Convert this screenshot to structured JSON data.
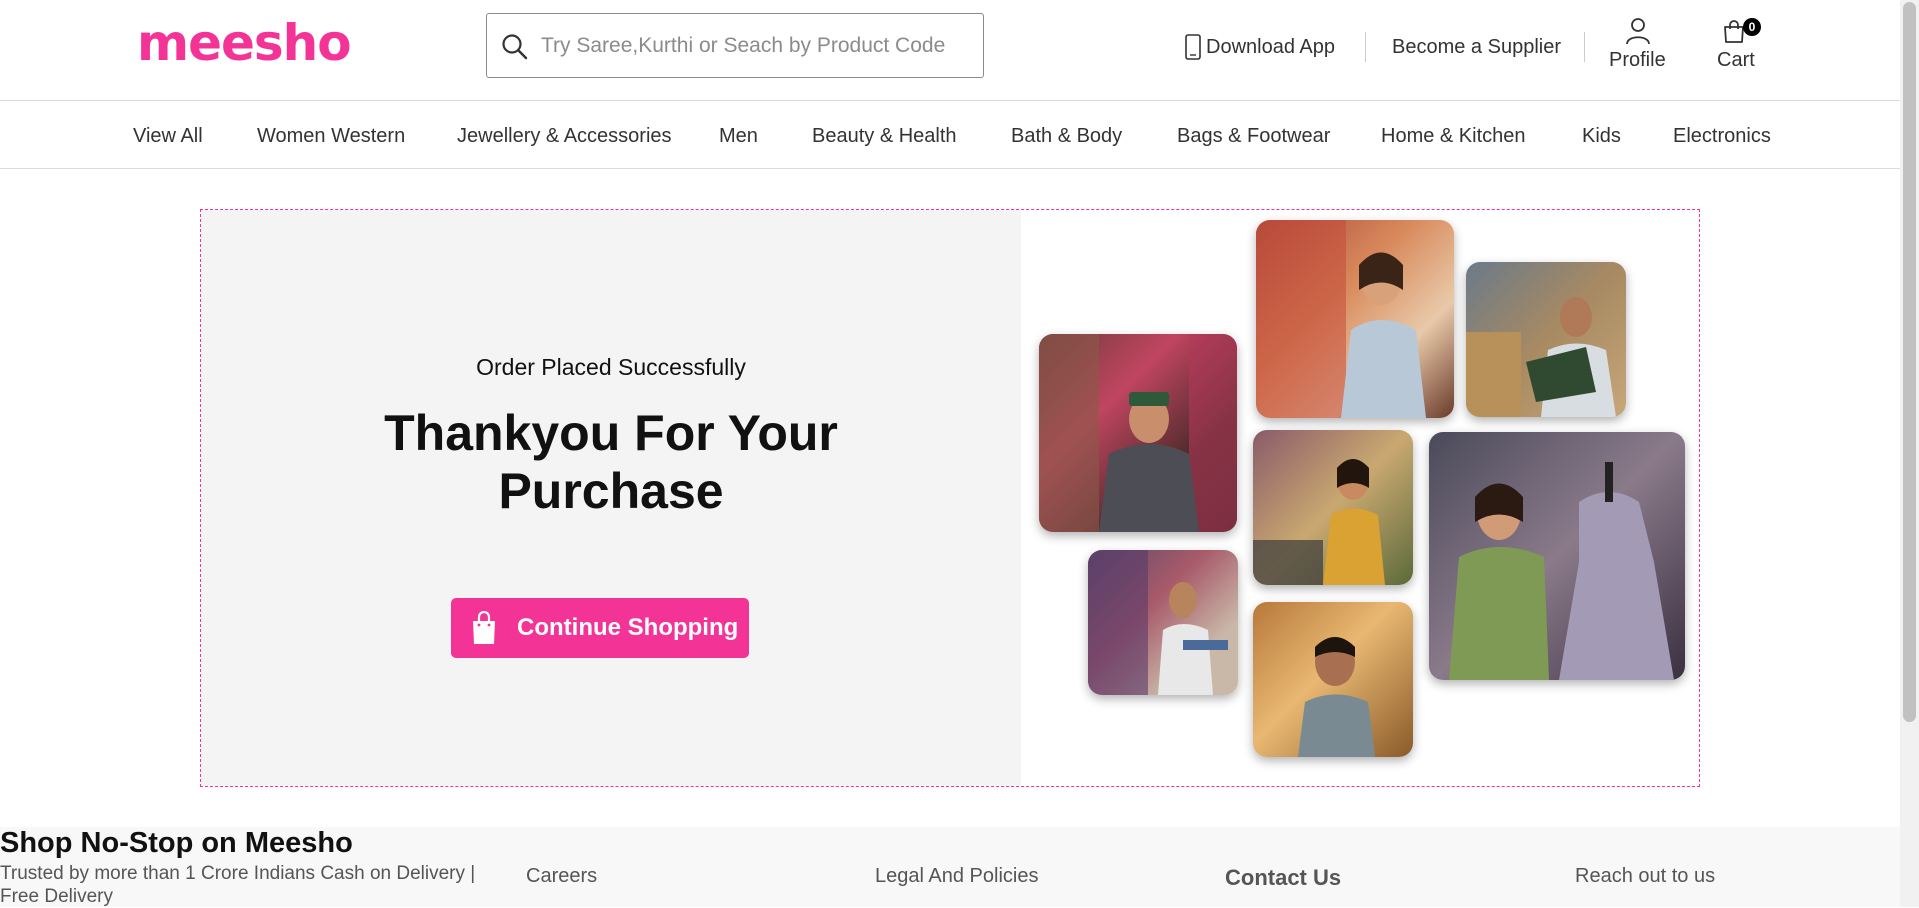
{
  "brand": {
    "logo": "meesho",
    "accent": "#f43397"
  },
  "search": {
    "placeholder": "Try Saree,Kurthi or Seach by Product Code"
  },
  "header": {
    "download_app": "Download App",
    "become_supplier": "Become a Supplier",
    "profile": "Profile",
    "cart": "Cart",
    "cart_count": "0"
  },
  "categories": [
    "View All",
    "Women Western",
    "Jewellery & Accessories",
    "Men",
    "Beauty & Health",
    "Bath & Body",
    "Bags & Footwear",
    "Home & Kitchen",
    "Kids",
    "Electronics"
  ],
  "hero": {
    "status": "Order Placed Successfully",
    "headline_line1": "Thankyou For Your",
    "headline_line2": "Purchase",
    "cta": "Continue Shopping"
  },
  "footer": {
    "heading": "Shop No-Stop on Meesho",
    "tagline": "Trusted by more than 1 Crore Indians Cash on Delivery | Free Delivery",
    "careers": "Careers",
    "legal": "Legal And Policies",
    "contact": "Contact Us",
    "reach_out": "Reach out to us"
  }
}
